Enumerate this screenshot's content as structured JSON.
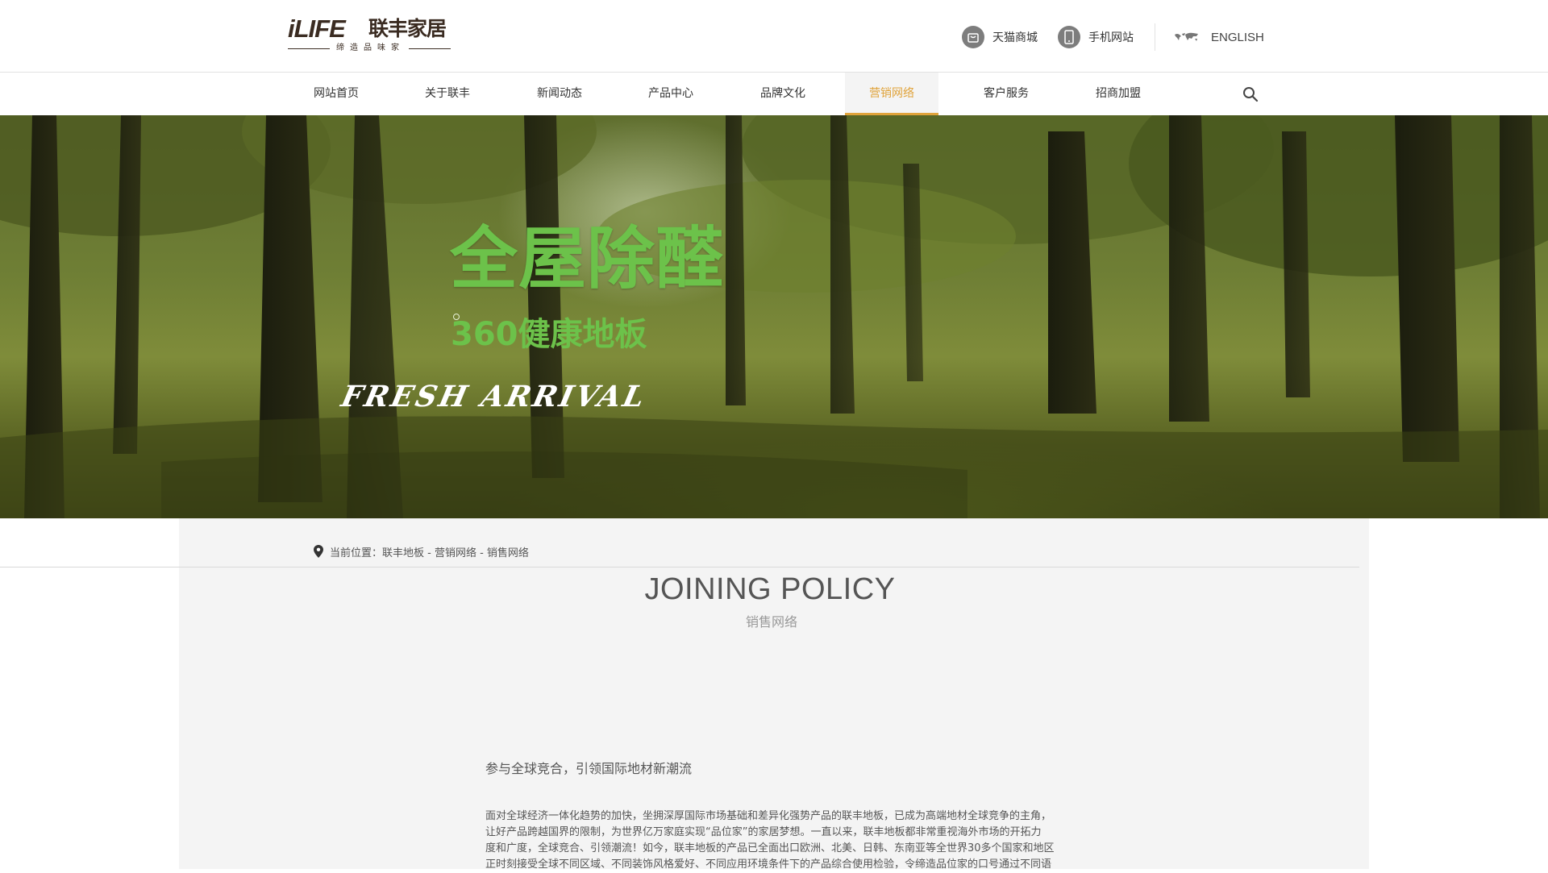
{
  "brand": {
    "logo_mark": "iLIFE",
    "logo_cn": "联丰家居",
    "tagline": "缔造品味家"
  },
  "top_links": {
    "tmall": "天猫商城",
    "mobile": "手机网站",
    "english": "ENGLISH"
  },
  "nav": {
    "items": [
      {
        "label": "网站首页"
      },
      {
        "label": "关于联丰"
      },
      {
        "label": "新闻动态"
      },
      {
        "label": "产品中心"
      },
      {
        "label": "品牌文化"
      },
      {
        "label": "营销网络",
        "active": true
      },
      {
        "label": "客户服务"
      },
      {
        "label": "招商加盟"
      }
    ],
    "active_color": "#e0a33b"
  },
  "banner": {
    "title": "全屋除醛",
    "subtitle": "360健康地板",
    "english": "FRESH ARRIVAL",
    "accent_color": "#6cc24a"
  },
  "breadcrumb": {
    "prefix": "当前位置：",
    "path": "联丰地板 - 营销网络 - 销售网络"
  },
  "section": {
    "title": "JOINING POLICY",
    "subtitle": "销售网络"
  },
  "article": {
    "heading": "参与全球竞合，引领国际地材新潮流",
    "lines": [
      "面对全球经济一体化趋势的加快，坐拥深厚国际市场基础和差异化强势产品的联丰地板，已成为高端地材全球竞争的主角，",
      "让好产品跨越国界的限制，为世界亿万家庭实现“品位家”的家居梦想。一直以来，联丰地板都非常重视海外市场的开拓力",
      "度和广度，全球竞合、引领潮流！如今，联丰地板的产品已全面出口欧洲、北美、日韩、东南亚等全世界30多个国家和地区",
      "正时刻接受全球不同区域、不同装饰风格爱好、不同应用环境条件下的产品综合使用检验，令缔造品位家的口号通过不同语"
    ]
  }
}
